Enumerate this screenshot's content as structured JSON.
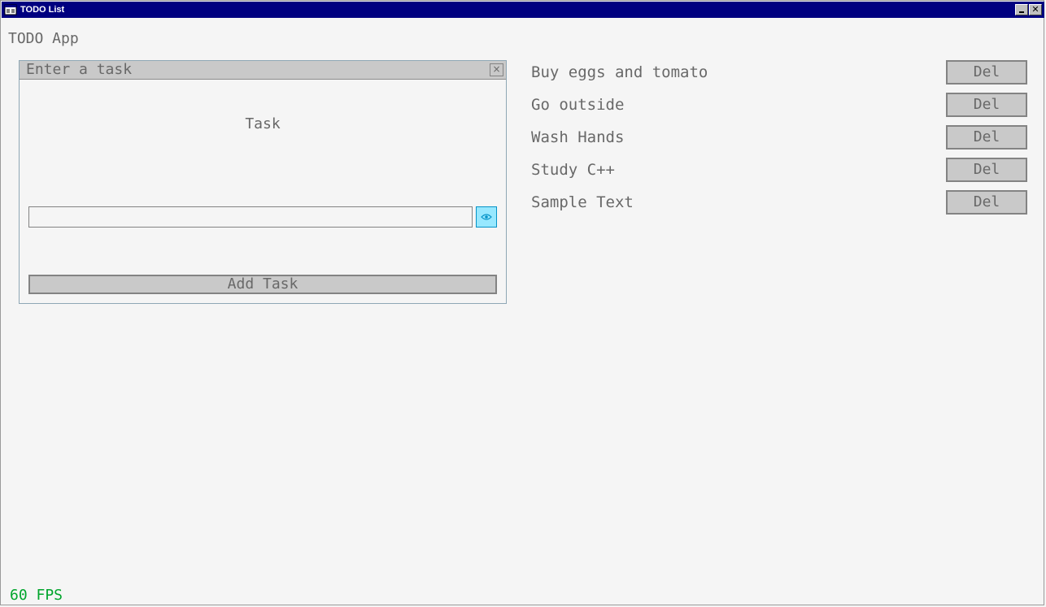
{
  "window": {
    "title": "TODO List"
  },
  "app": {
    "title": "TODO App"
  },
  "panel": {
    "title": "Enter a task",
    "close_glyph": "×",
    "field_label": "Task",
    "input_value": "",
    "add_button_label": "Add Task"
  },
  "todos": [
    {
      "text": "Buy eggs and tomato",
      "delete_label": "Del"
    },
    {
      "text": "Go outside",
      "delete_label": "Del"
    },
    {
      "text": "Wash Hands",
      "delete_label": "Del"
    },
    {
      "text": "Study C++",
      "delete_label": "Del"
    },
    {
      "text": "Sample Text",
      "delete_label": "Del"
    }
  ],
  "status": {
    "fps": "60 FPS"
  },
  "colors": {
    "titlebar": "#000080",
    "background": "#f5f5f5",
    "text": "#686868",
    "button_face": "#c9c9c9",
    "accent": "#97e8ff",
    "fps": "#00a52c"
  },
  "icons": {
    "app": "window-icon",
    "minimize": "minimize-icon",
    "close": "close-icon",
    "panel_close": "close-icon",
    "visibility": "eye-icon"
  }
}
